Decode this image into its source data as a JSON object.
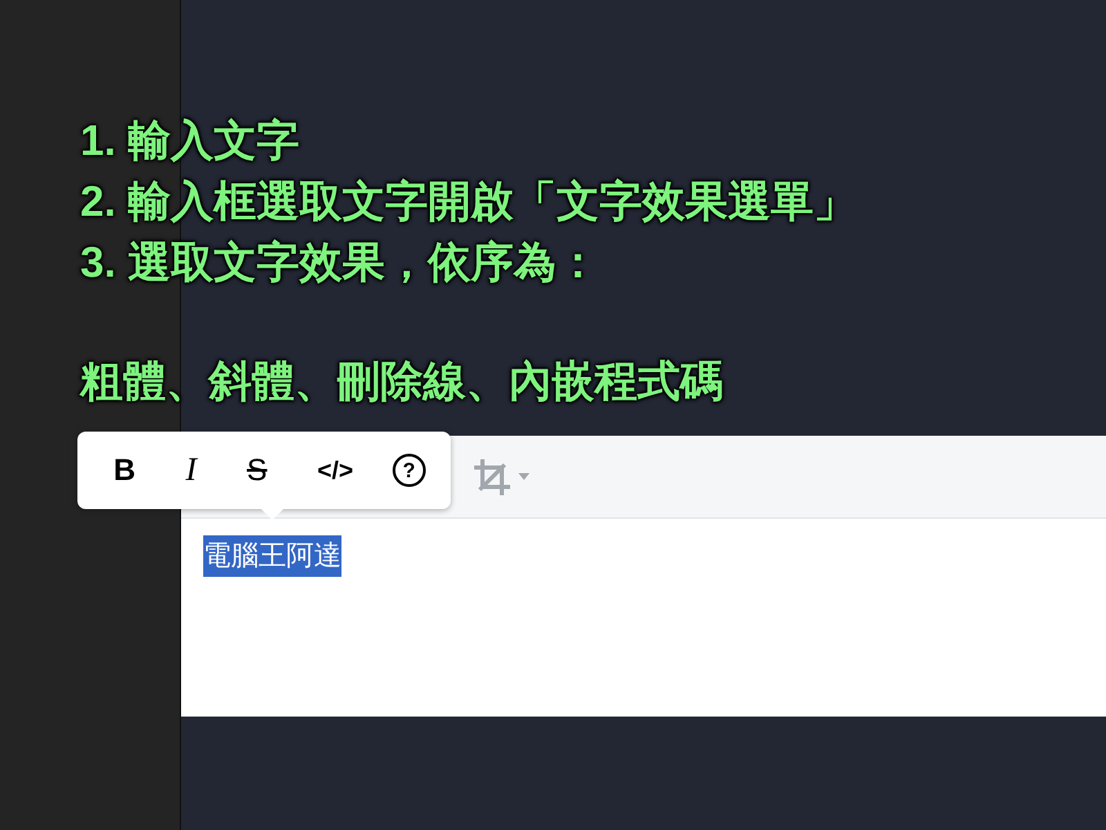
{
  "annotation": {
    "steps": [
      "1. 輸入文字",
      "2. 輸入框選取文字開啟「文字效果選單」",
      "3. 選取文字效果，依序為："
    ],
    "effects_line": "粗體、斜體、刪除線、內嵌程式碼"
  },
  "format_popup": {
    "buttons": [
      {
        "kind": "bold",
        "label": "B"
      },
      {
        "kind": "italic",
        "label": "I"
      },
      {
        "kind": "strike",
        "label": "S"
      },
      {
        "kind": "code",
        "label": "</>"
      },
      {
        "kind": "help",
        "label": "?"
      }
    ]
  },
  "editor": {
    "text": "電腦王阿達",
    "selected": true
  }
}
